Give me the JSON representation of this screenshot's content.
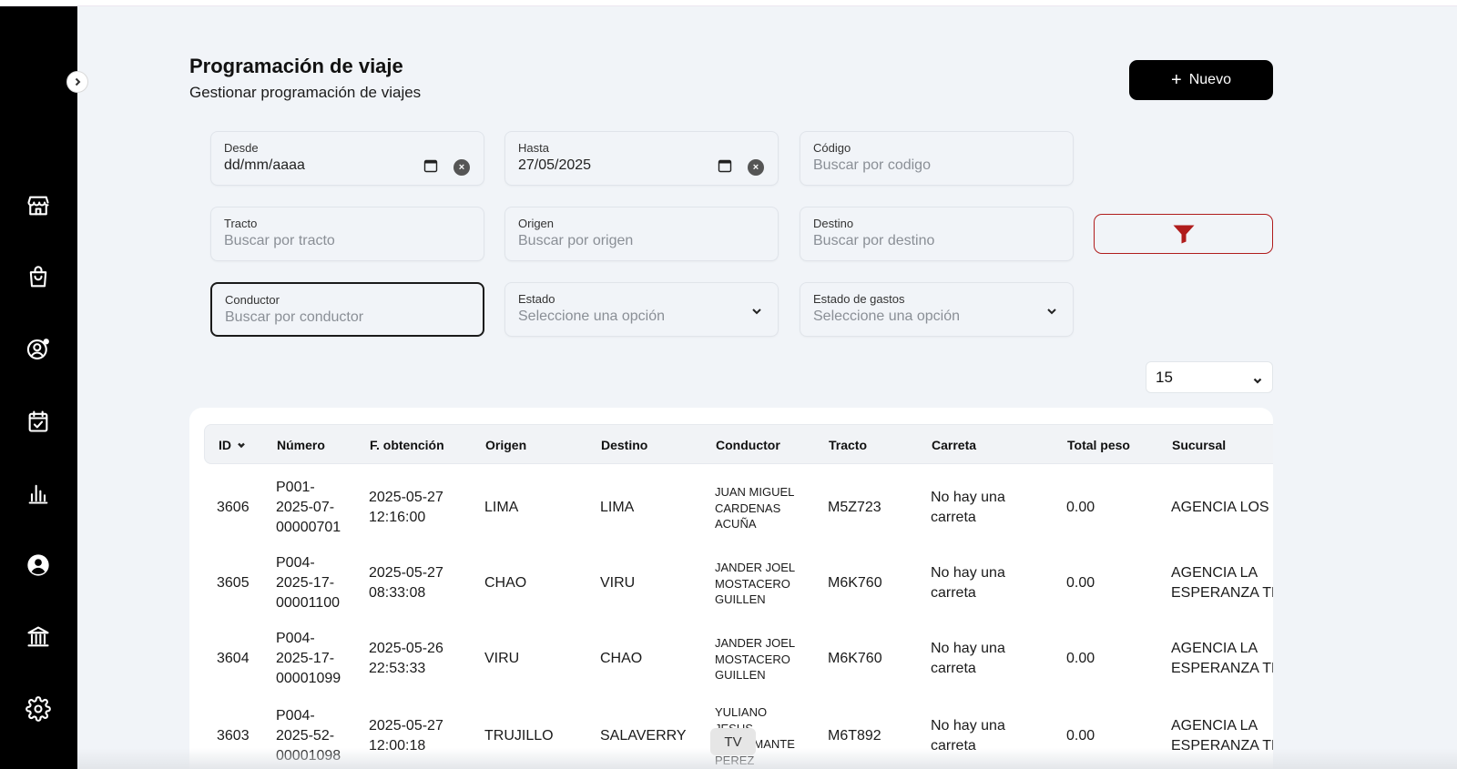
{
  "header": {
    "title": "Programación de viaje",
    "subtitle": "Gestionar programación de viajes",
    "new_label": "Nuevo"
  },
  "sidebar": {
    "items": [
      {
        "icon": "store-icon"
      },
      {
        "icon": "shopping-bag-icon"
      },
      {
        "icon": "user-settings-icon"
      },
      {
        "icon": "calendar-check-icon"
      },
      {
        "icon": "bar-chart-icon"
      },
      {
        "icon": "user-circle-icon"
      },
      {
        "icon": "bank-icon"
      },
      {
        "icon": "gear-icon"
      }
    ]
  },
  "filters": {
    "desde": {
      "label": "Desde",
      "value": "dd/mm/aaaa"
    },
    "hasta": {
      "label": "Hasta",
      "value": "27/05/2025"
    },
    "codigo": {
      "label": "Código",
      "placeholder": "Buscar por codigo"
    },
    "tracto": {
      "label": "Tracto",
      "placeholder": "Buscar por tracto"
    },
    "origen": {
      "label": "Origen",
      "placeholder": "Buscar por origen"
    },
    "destino": {
      "label": "Destino",
      "placeholder": "Buscar por destino"
    },
    "conductor": {
      "label": "Conductor",
      "placeholder": "Buscar por conductor"
    },
    "estado": {
      "label": "Estado",
      "placeholder": "Seleccione una opción"
    },
    "estado_gastos": {
      "label": "Estado de gastos",
      "placeholder": "Seleccione una opción"
    }
  },
  "page_size": "15",
  "table": {
    "columns": [
      "ID",
      "Número",
      "F. obtención",
      "Origen",
      "Destino",
      "Conductor",
      "Tracto",
      "Carreta",
      "Total peso",
      "Sucursal"
    ],
    "rows": [
      {
        "id": "3606",
        "numero": [
          "P001-",
          "2025-07-",
          "00000701"
        ],
        "fecha": [
          "2025-05-27",
          "12:16:00"
        ],
        "origen": "LIMA",
        "destino": "LIMA",
        "conductor": [
          "JUAN MIGUEL",
          "CARDENAS",
          "ACUÑA"
        ],
        "tracto": "M5Z723",
        "carreta": [
          "No hay una",
          "carreta"
        ],
        "peso": "0.00",
        "sucursal": [
          "AGENCIA LOS C"
        ]
      },
      {
        "id": "3605",
        "numero": [
          "P004-",
          "2025-17-",
          "00001100"
        ],
        "fecha": [
          "2025-05-27",
          "08:33:08"
        ],
        "origen": "CHAO",
        "destino": "VIRU",
        "conductor": [
          "JANDER JOEL",
          "MOSTACERO",
          "GUILLEN"
        ],
        "tracto": "M6K760",
        "carreta": [
          "No hay una",
          "carreta"
        ],
        "peso": "0.00",
        "sucursal": [
          "AGENCIA LA",
          "ESPERANZA TR"
        ]
      },
      {
        "id": "3604",
        "numero": [
          "P004-",
          "2025-17-",
          "00001099"
        ],
        "fecha": [
          "2025-05-26",
          "22:53:33"
        ],
        "origen": "VIRU",
        "destino": "CHAO",
        "conductor": [
          "JANDER JOEL",
          "MOSTACERO",
          "GUILLEN"
        ],
        "tracto": "M6K760",
        "carreta": [
          "No hay una",
          "carreta"
        ],
        "peso": "0.00",
        "sucursal": [
          "AGENCIA LA",
          "ESPERANZA TR"
        ]
      },
      {
        "id": "3603",
        "numero": [
          "P004-",
          "2025-52-",
          "00001098"
        ],
        "fecha": [
          "2025-05-27",
          "12:00:18"
        ],
        "origen": "TRUJILLO",
        "destino": "SALAVERRY",
        "conductor": [
          "YULIANO",
          "JESUS",
          "BUSTAMANTE",
          "PEREZ"
        ],
        "tracto": "M6T892",
        "carreta": [
          "No hay una",
          "carreta"
        ],
        "peso": "0.00",
        "sucursal": [
          "AGENCIA LA",
          "ESPERANZA TR"
        ]
      }
    ]
  },
  "tv_badge": "TV",
  "colors": {
    "sidebar": "#000000",
    "background": "#f1f4f8",
    "filter_accent": "#b01c1c",
    "primary_button": "#000000"
  }
}
